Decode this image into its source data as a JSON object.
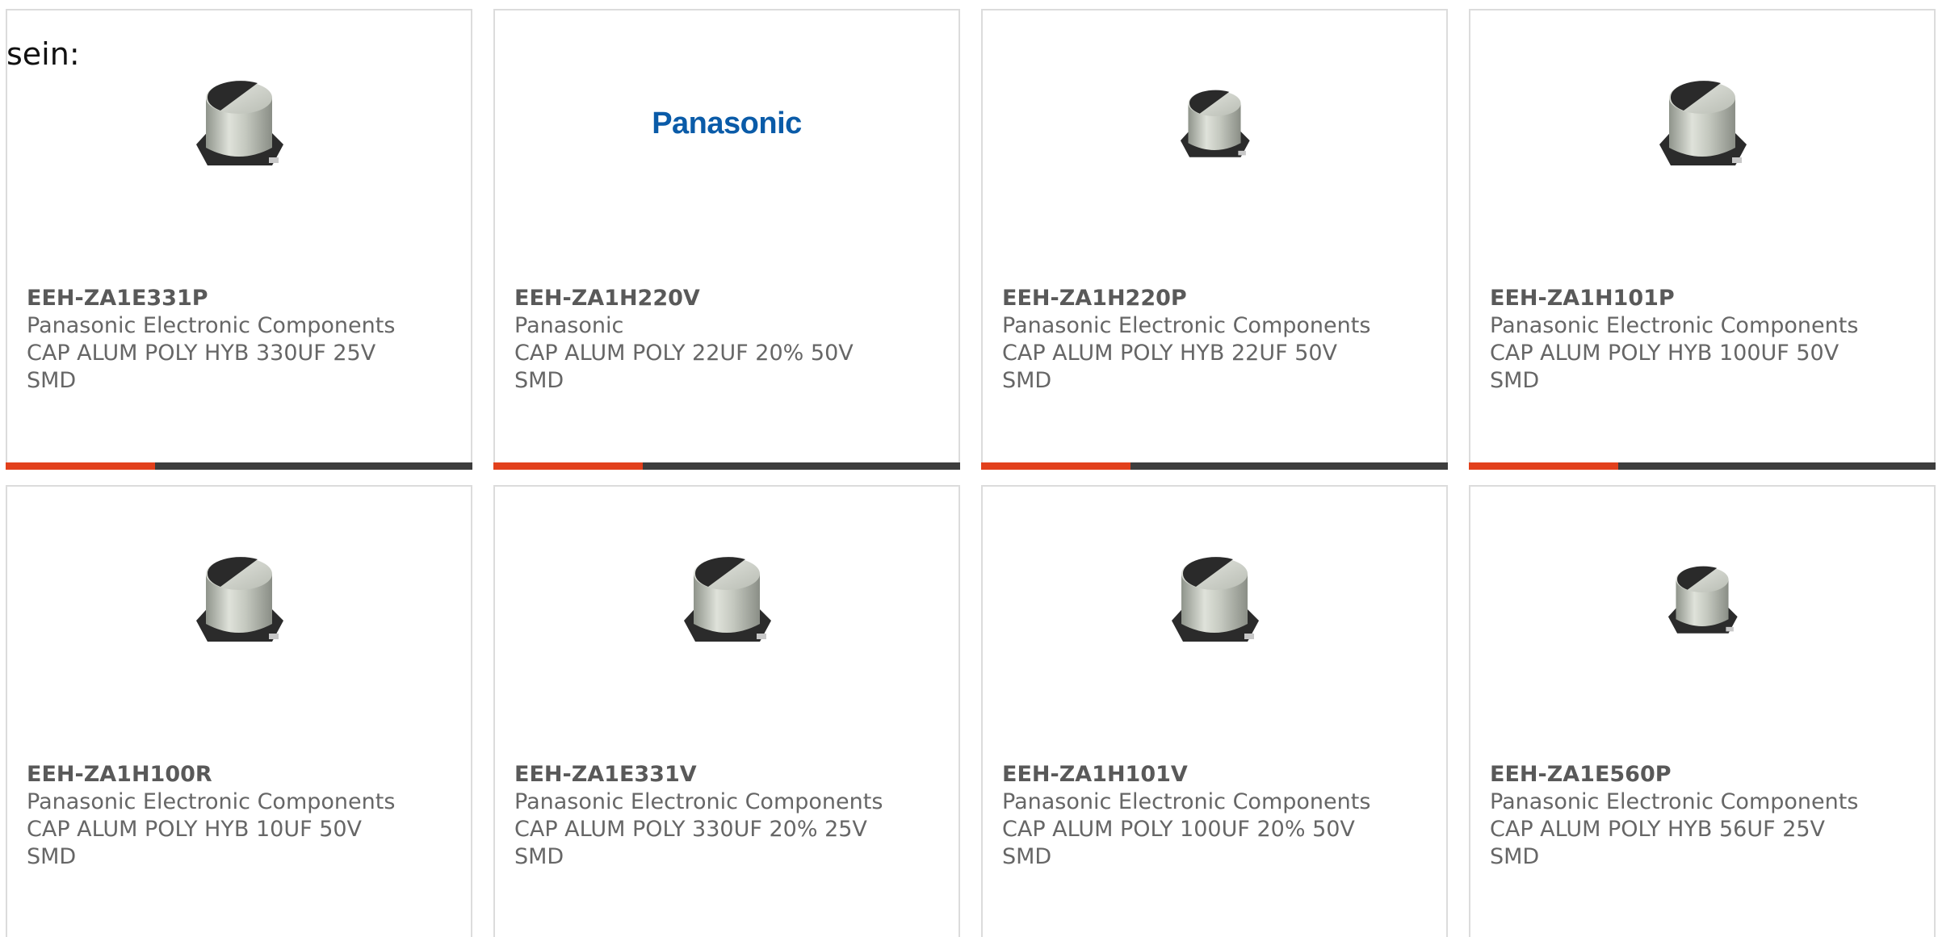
{
  "intro_text": "sein:",
  "accent_color": "#e2401c",
  "track_color": "#3d3d3d",
  "products": [
    {
      "part_number": "EEH-ZA1E331P",
      "manufacturer": "Panasonic Electronic Components",
      "description_line1": "CAP ALUM POLY HYB 330UF 25V",
      "description_line2": "SMD",
      "image": "capacitor-icon",
      "progress": 0.32
    },
    {
      "part_number": "EEH-ZA1H220V",
      "manufacturer": "Panasonic",
      "description_line1": "CAP ALUM POLY 22UF 20% 50V",
      "description_line2": "SMD",
      "image": "panasonic-logo",
      "logo_text": "Panasonic",
      "progress": 0.32
    },
    {
      "part_number": "EEH-ZA1H220P",
      "manufacturer": "Panasonic Electronic Components",
      "description_line1": "CAP ALUM POLY HYB 22UF 50V",
      "description_line2": "SMD",
      "image": "capacitor-icon",
      "progress": 0.32
    },
    {
      "part_number": "EEH-ZA1H101P",
      "manufacturer": "Panasonic Electronic Components",
      "description_line1": "CAP ALUM POLY HYB 100UF 50V",
      "description_line2": "SMD",
      "image": "capacitor-icon",
      "progress": 0.32
    },
    {
      "part_number": "EEH-ZA1H100R",
      "manufacturer": "Panasonic Electronic Components",
      "description_line1": "CAP ALUM POLY HYB 10UF 50V",
      "description_line2": "SMD",
      "image": "capacitor-icon"
    },
    {
      "part_number": "EEH-ZA1E331V",
      "manufacturer": "Panasonic Electronic Components",
      "description_line1": "CAP ALUM POLY 330UF 20% 25V",
      "description_line2": "SMD",
      "image": "capacitor-icon"
    },
    {
      "part_number": "EEH-ZA1H101V",
      "manufacturer": "Panasonic Electronic Components",
      "description_line1": "CAP ALUM POLY 100UF 20% 50V",
      "description_line2": "SMD",
      "image": "capacitor-icon"
    },
    {
      "part_number": "EEH-ZA1E560P",
      "manufacturer": "Panasonic Electronic Components",
      "description_line1": "CAP ALUM POLY HYB 56UF 25V",
      "description_line2": "SMD",
      "image": "capacitor-icon"
    }
  ]
}
